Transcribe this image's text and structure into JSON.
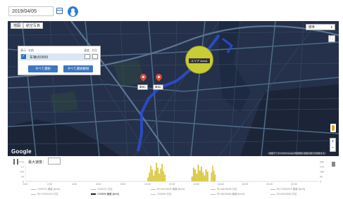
{
  "header": {
    "date_value": "2019/04/05"
  },
  "map": {
    "tabs": [
      "地図",
      "航空写真"
    ],
    "panel": {
      "headers": [
        "表示",
        "名前",
        "速度",
        "方位"
      ],
      "row": {
        "name": "车辆点9999",
        "checked": true
      },
      "buttons": [
        "すべて選択",
        "すべて選択解除"
      ]
    },
    "area_label": "エリア Area1",
    "pins": [
      {
        "label": "車両1",
        "color": "#e04a3a"
      },
      {
        "label": "車両2",
        "color": "#e04a3a"
      }
    ],
    "map_type": "標準",
    "fullscreen_glyph": "⛶",
    "zoom_in": "+",
    "zoom_out": "−",
    "google_logo": "Google",
    "attribution": "地図データ ©2019 Google 利用規約 地図の誤りを報告する",
    "colors": {
      "map_bg": "#25304a",
      "road": "#3f5f7a",
      "route": "#2a4fd6",
      "area_fill": "#c9cc36"
    }
  },
  "chart": {
    "speed_label": "最大速度：",
    "left_axis": [
      "2711",
      "1.1",
      "100",
      "20",
      "0"
    ],
    "right_axis": [
      "360",
      "270",
      "180",
      "90",
      "0"
    ],
    "x_ticks": [
      "0:00",
      "2:00",
      "4:00",
      "6:00",
      "8:00",
      "10:00",
      "12:00",
      "14:00",
      "16:00",
      "18:00",
      "20:00",
      "22:00"
    ],
    "legend": [
      "CS0XXX 速度 [km/h]",
      "CS0XXX 方位",
      "R0-M1234A5 速度 [km/h]",
      "R0-M1234A5 方位",
      "R0-T0154X15 速度 [km/h]",
      "R0-T0154X15 方位",
      "CS0999 速度 [km/h]",
      "CS0999 方位",
      "R0-M12345A 速度 [km/h]",
      "R0-M12345A 方位"
    ],
    "legend_dark_index": 6
  },
  "chart_data": {
    "type": "bar",
    "xlabel": "",
    "ylabel": "",
    "x_ticks": [
      "0:00",
      "2:00",
      "4:00",
      "6:00",
      "8:00",
      "10:00",
      "12:00",
      "14:00",
      "16:00",
      "18:00",
      "20:00",
      "22:00"
    ],
    "series": [
      {
        "name": "CS0999 速度 [km/h]",
        "color": "#d9c83a",
        "segments": [
          {
            "hour_start": 10.0,
            "hour_end": 11.5,
            "values": [
              20,
              45,
              80,
              60,
              30,
              55,
              95,
              70,
              40,
              65,
              90,
              50,
              35
            ]
          },
          {
            "hour_start": 13.6,
            "hour_end": 15.0,
            "values": [
              25,
              70,
              60,
              40,
              85,
              55,
              75,
              45,
              30,
              60,
              50
            ]
          },
          {
            "hour_start": 15.2,
            "hour_end": 15.6,
            "values": [
              45,
              80,
              55,
              35
            ]
          }
        ]
      }
    ]
  }
}
